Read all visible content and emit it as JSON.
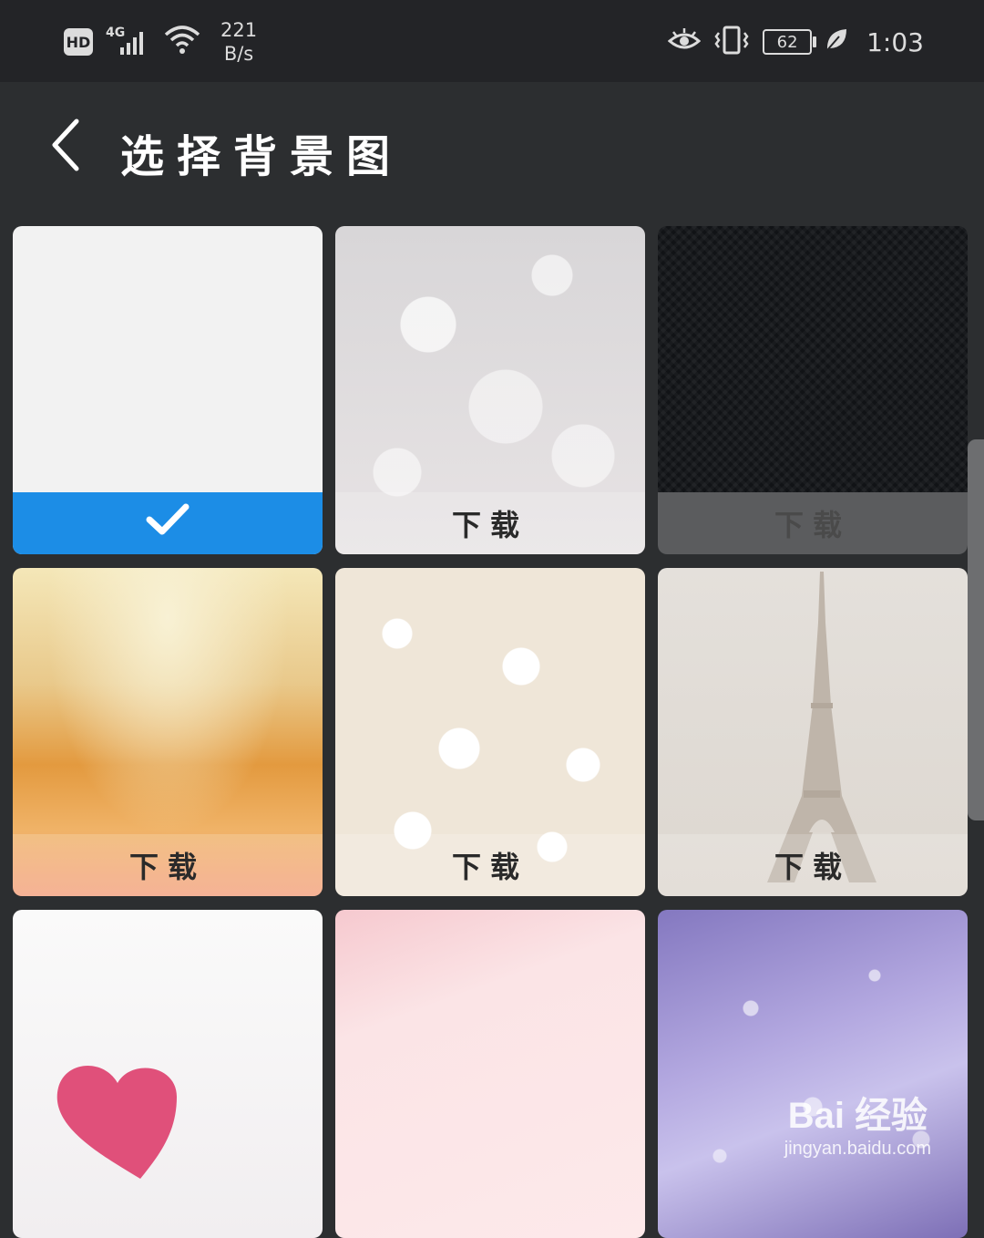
{
  "status_bar": {
    "hd": "HD",
    "network": "4G",
    "speed_value": "221",
    "speed_unit": "B/s",
    "battery": "62",
    "time": "1:03",
    "icons": [
      "signal-icon",
      "wifi-icon",
      "eye-icon",
      "vibrate-icon",
      "battery-icon",
      "leaf-icon"
    ]
  },
  "header": {
    "back_icon": "chevron-left-icon",
    "title": "选择背景图"
  },
  "backgrounds": [
    {
      "caption": "",
      "selected": true,
      "style": "white"
    },
    {
      "caption": "下载",
      "selected": false,
      "style": "bokeh"
    },
    {
      "caption": "下载",
      "selected": false,
      "style": "dark"
    },
    {
      "caption": "下载",
      "selected": false,
      "style": "gold"
    },
    {
      "caption": "下载",
      "selected": false,
      "style": "flowers"
    },
    {
      "caption": "下载",
      "selected": false,
      "style": "eiffel"
    },
    {
      "caption": "",
      "selected": false,
      "style": "heart"
    },
    {
      "caption": "",
      "selected": false,
      "style": "pink"
    },
    {
      "caption": "",
      "selected": false,
      "style": "drops"
    }
  ],
  "watermark": {
    "main": "Bai 经验",
    "sub": "jingyan.baidu.com"
  },
  "colors": {
    "background": "#2c2e30",
    "status_bar": "#232427",
    "selected_accent": "#1c8de6"
  }
}
